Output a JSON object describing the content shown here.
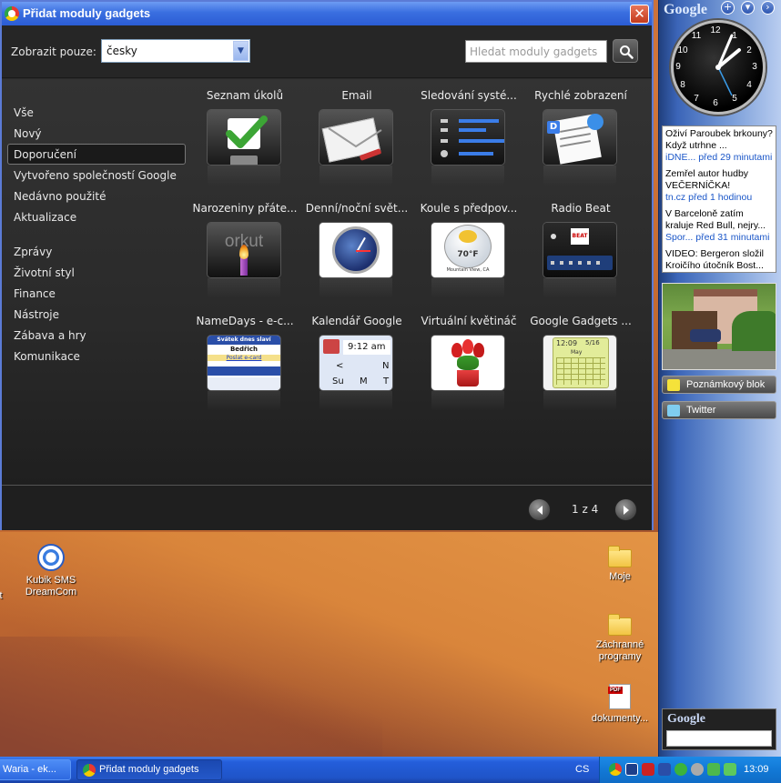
{
  "dialog": {
    "title": "Přidat moduly gadgets",
    "close_label": "✕",
    "filter_label": "Zobrazit pouze:",
    "language_value": "česky",
    "search_placeholder": "Hledat moduly gadgets"
  },
  "categories_primary": [
    "Vše",
    "Nový",
    "Doporučení",
    "Vytvořeno společností Google",
    "Nedávno použité",
    "Aktualizace"
  ],
  "categories_secondary": [
    "Zprávy",
    "Životní styl",
    "Finance",
    "Nástroje",
    "Zábava a hry",
    "Komunikace"
  ],
  "active_category": "Doporučení",
  "gadgets": [
    {
      "title": "Seznam úkolů",
      "icon": "checkmark-icon"
    },
    {
      "title": "Email",
      "icon": "envelope-icon"
    },
    {
      "title": "Sledování systé...",
      "icon": "system-monitor-icon"
    },
    {
      "title": "Rychlé zobrazení",
      "icon": "pushpin-note-icon"
    },
    {
      "title": "Narozeniny přáte...",
      "icon": "orkut-candle-icon"
    },
    {
      "title": "Denní/noční svět...",
      "icon": "world-clock-icon"
    },
    {
      "title": "Koule s předpov...",
      "icon": "weather-globe-icon"
    },
    {
      "title": "Radio Beat",
      "icon": "radio-player-icon"
    },
    {
      "title": "NameDays - e-c...",
      "icon": "nameday-card-icon"
    },
    {
      "title": "Kalendář Google",
      "icon": "calendar-icon"
    },
    {
      "title": "Virtuální květináč",
      "icon": "tulip-pot-icon"
    },
    {
      "title": "Google Gadgets ...",
      "icon": "calendar-grid-icon"
    }
  ],
  "gadget_thumb_text": {
    "orkut": "orkut",
    "weather_temp": "70°F",
    "weather_place": "Mountain View, CA",
    "radio_logo": "BEAT",
    "nameday_header": "Svátek dnes slaví",
    "nameday_name": "Bedřich",
    "nameday_link": "Poslat e-card",
    "calendar_time": "9:12 am",
    "calendar_prev": "<",
    "calendar_next": "N",
    "calendar_days": [
      "Su",
      "M",
      "T"
    ],
    "grid_date": "12:09",
    "grid_day": "5/16",
    "grid_month": "May"
  },
  "pagination": {
    "current": "1 z 4"
  },
  "google_sidebar": {
    "logo": "Google",
    "add_button": "+",
    "menu_button": "▾",
    "collapse_button": "›",
    "clock_numbers": [
      "12",
      "1",
      "2",
      "3",
      "4",
      "5",
      "6",
      "7",
      "8",
      "9",
      "10",
      "11"
    ],
    "news": [
      {
        "headline": "Oživí Paroubek brkouny? Když utrhne ...",
        "source": "iDNE...",
        "time": "před 29 minutami"
      },
      {
        "headline": "Zemřel autor hudby VEČERNÍČKA!",
        "source": "tn.cz",
        "time": "před 1 hodinou"
      },
      {
        "headline": "V Barceloně zatím kraluje Red Bull, nejry...",
        "source": "Spor...",
        "time": "před 31 minutami"
      },
      {
        "headline": "VIDEO: Bergeron složil Kroičího útočník Bost...",
        "source": "",
        "time": ""
      }
    ],
    "notepad_label": "Poznámkový blok",
    "twitter_label": "Twitter",
    "search_logo": "Google"
  },
  "desktop_icons": [
    {
      "label": "Kubik SMS DreamCom"
    },
    {
      "label": "Moje"
    },
    {
      "label": "Záchranné programy"
    },
    {
      "label": "dokumenty..."
    }
  ],
  "desktop_edge_label": "t",
  "taskbar": {
    "tasks": [
      "Waria - ek...",
      "Přidat moduly gadgets"
    ],
    "language": "CS",
    "time": "13:09"
  },
  "colors": {
    "accent": "#2b5cd4",
    "taskbar": "#245edb",
    "dialog_bg": "#2a2a2a"
  }
}
